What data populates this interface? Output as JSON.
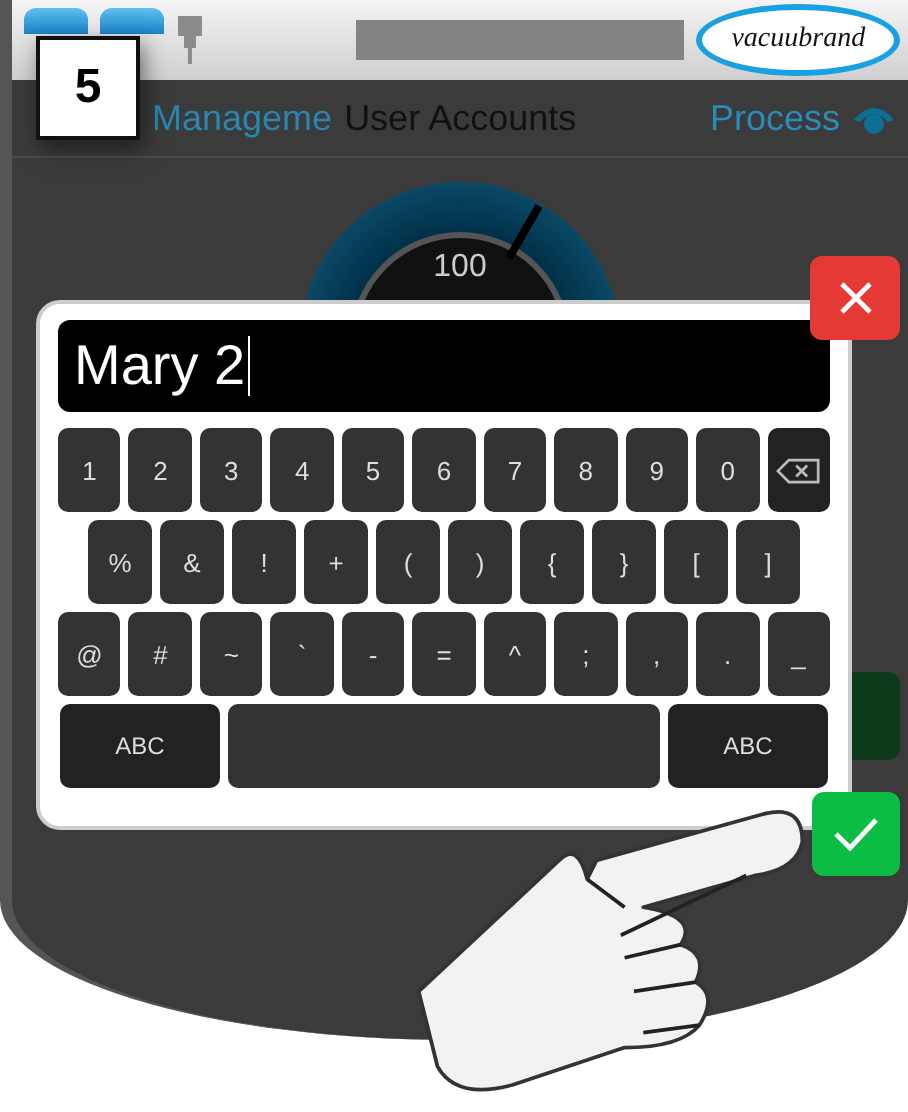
{
  "header": {
    "step": "5",
    "logo": "vacuubrand"
  },
  "nav": {
    "back": "Manageme",
    "title": "User Accounts",
    "forward": "Process"
  },
  "gauge": {
    "reading": "100"
  },
  "keyboard": {
    "value": "Mary 2",
    "rows": [
      [
        {
          "kind": "char",
          "label": "1"
        },
        {
          "kind": "char",
          "label": "2"
        },
        {
          "kind": "char",
          "label": "3"
        },
        {
          "kind": "char",
          "label": "4"
        },
        {
          "kind": "char",
          "label": "5"
        },
        {
          "kind": "char",
          "label": "6"
        },
        {
          "kind": "char",
          "label": "7"
        },
        {
          "kind": "char",
          "label": "8"
        },
        {
          "kind": "char",
          "label": "9"
        },
        {
          "kind": "char",
          "label": "0"
        },
        {
          "kind": "backspace"
        }
      ],
      [
        {
          "kind": "char",
          "label": "%"
        },
        {
          "kind": "char",
          "label": "&"
        },
        {
          "kind": "char",
          "label": "!"
        },
        {
          "kind": "char",
          "label": "+"
        },
        {
          "kind": "char",
          "label": "("
        },
        {
          "kind": "char",
          "label": ")"
        },
        {
          "kind": "char",
          "label": "{"
        },
        {
          "kind": "char",
          "label": "}"
        },
        {
          "kind": "char",
          "label": "["
        },
        {
          "kind": "char",
          "label": "]"
        }
      ],
      [
        {
          "kind": "char",
          "label": "@"
        },
        {
          "kind": "char",
          "label": "#"
        },
        {
          "kind": "char",
          "label": "~"
        },
        {
          "kind": "char",
          "label": "`"
        },
        {
          "kind": "char",
          "label": "-"
        },
        {
          "kind": "char",
          "label": "="
        },
        {
          "kind": "char",
          "label": "^"
        },
        {
          "kind": "char",
          "label": ";"
        },
        {
          "kind": "char",
          "label": ","
        },
        {
          "kind": "char",
          "label": "."
        },
        {
          "kind": "char",
          "label": "_"
        }
      ]
    ],
    "bottom_bar": {
      "left_mode": "ABC",
      "right_mode": "ABC"
    }
  }
}
